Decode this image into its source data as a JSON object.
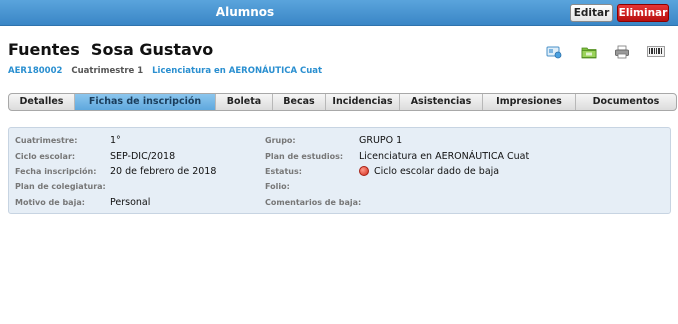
{
  "header": {
    "title": "Alumnos",
    "edit_label": "Editar",
    "delete_label": "Eliminar"
  },
  "student": {
    "name": "Fuentes  Sosa Gustavo",
    "code": "AER180002",
    "cuatrimestre": "Cuatrimestre 1",
    "licenciatura": "Licenciatura en AERONÁUTICA Cuat"
  },
  "toolbar_icons": [
    "card-icon",
    "folder-icon",
    "printer-icon",
    "barcode-icon"
  ],
  "tabs": [
    {
      "label": "Detalles",
      "active": false
    },
    {
      "label": "Fichas de inscripción",
      "active": true
    },
    {
      "label": "Boleta",
      "active": false
    },
    {
      "label": "Becas",
      "active": false
    },
    {
      "label": "Incidencias",
      "active": false
    },
    {
      "label": "Asistencias",
      "active": false
    },
    {
      "label": "Impresiones",
      "active": false
    },
    {
      "label": "Documentos",
      "active": false
    }
  ],
  "details": {
    "left": [
      {
        "label": "Cuatrimestre:",
        "value": "1°"
      },
      {
        "label": "Ciclo escolar:",
        "value": "SEP-DIC/2018"
      },
      {
        "label": "Fecha inscripción:",
        "value": "20 de febrero de 2018"
      },
      {
        "label": "Plan de colegiatura:",
        "value": ""
      },
      {
        "label": "Motivo de baja:",
        "value": "Personal"
      }
    ],
    "right": [
      {
        "label": "Grupo:",
        "value": "GRUPO 1"
      },
      {
        "label": "Plan de estudios:",
        "value": "Licenciatura en AERONÁUTICA Cuat"
      },
      {
        "label": "Estatus:",
        "value": "Ciclo escolar dado de baja"
      },
      {
        "label": "Folio:",
        "value": ""
      },
      {
        "label": "Comentarios de baja:",
        "value": ""
      }
    ],
    "status_color": "#d22b1c"
  },
  "colors": {
    "header_bar": "#3a86c6",
    "accent_text": "#2a8fd0",
    "active_tab": "#5fa8de",
    "delete_button": "#c41b1b",
    "panel_bg": "#e6eef6"
  }
}
